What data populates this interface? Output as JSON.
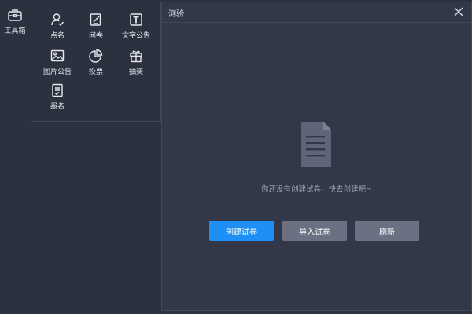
{
  "rail": {
    "toolbox_label": "工具箱"
  },
  "tools": [
    {
      "label": "点名",
      "icon": "roll-call-icon"
    },
    {
      "label": "问卷",
      "icon": "questionnaire-icon"
    },
    {
      "label": "文字公告",
      "icon": "text-notice-icon"
    },
    {
      "label": "图片公告",
      "icon": "image-notice-icon"
    },
    {
      "label": "投票",
      "icon": "vote-icon"
    },
    {
      "label": "抽奖",
      "icon": "lottery-icon"
    },
    {
      "label": "报名",
      "icon": "signup-icon"
    }
  ],
  "dialog": {
    "title": "测验",
    "empty_text": "你还没有创建试卷，快去创建吧~",
    "create_label": "创建试卷",
    "import_label": "导入试卷",
    "refresh_label": "刷新"
  },
  "colors": {
    "background": "#2c3140",
    "dialog_bg": "#323848",
    "primary": "#1d8ff5",
    "secondary_button": "#6b7182",
    "muted_text": "#9aa1b1"
  }
}
